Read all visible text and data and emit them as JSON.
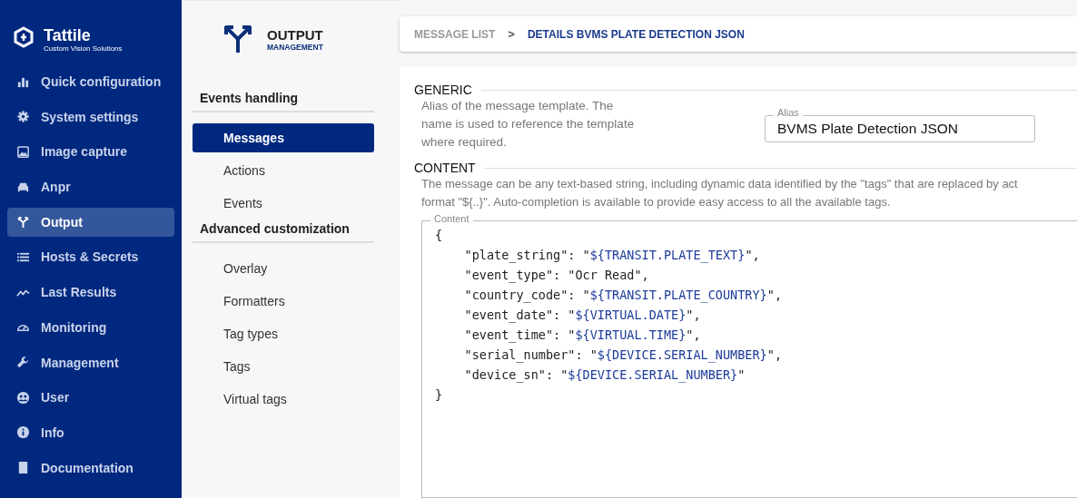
{
  "brand": {
    "name": "Tattile",
    "tagline": "Custom Vision Solutions"
  },
  "nav": [
    {
      "label": "Quick configuration",
      "selected": false
    },
    {
      "label": "System settings",
      "selected": false
    },
    {
      "label": "Image capture",
      "selected": false
    },
    {
      "label": "Anpr",
      "selected": false
    },
    {
      "label": "Output",
      "selected": true
    },
    {
      "label": "Hosts & Secrets",
      "selected": false
    },
    {
      "label": "Last Results",
      "selected": false
    },
    {
      "label": "Monitoring",
      "selected": false
    },
    {
      "label": "Management",
      "selected": false
    },
    {
      "label": "User",
      "selected": false
    },
    {
      "label": "Info",
      "selected": false
    },
    {
      "label": "Documentation",
      "selected": false
    }
  ],
  "section": {
    "title": "OUTPUT",
    "subtitle": "MANAGEMENT"
  },
  "submenu": [
    {
      "heading": "Events handling",
      "items": [
        {
          "label": "Messages",
          "selected": true
        },
        {
          "label": "Actions",
          "selected": false
        },
        {
          "label": "Events",
          "selected": false
        }
      ]
    },
    {
      "heading": "Advanced customization",
      "items": [
        {
          "label": "Overlay",
          "selected": false
        },
        {
          "label": "Formatters",
          "selected": false
        },
        {
          "label": "Tag types",
          "selected": false
        },
        {
          "label": "Tags",
          "selected": false
        },
        {
          "label": "Virtual tags",
          "selected": false
        }
      ]
    }
  ],
  "breadcrumb": {
    "parent": "MESSAGE LIST",
    "separator": ">",
    "current": "DETAILS BVMS PLATE DETECTION JSON"
  },
  "generic": {
    "title": "GENERIC",
    "description": "Alias of the message template. The name is used to reference the template where required.",
    "alias_label": "Alias",
    "alias_value": "BVMS Plate Detection JSON"
  },
  "content": {
    "title": "CONTENT",
    "description": [
      "The message can be any text-based string, including dynamic data identified by the \"tags\" that are replaced by act",
      "format \"${..}\". Auto-completion is available to provide easy access to all the available tags."
    ],
    "editor_label": "Content",
    "lines": [
      [
        {
          "kind": "plain",
          "text": "{"
        }
      ],
      [
        {
          "kind": "plain",
          "text": "    \"plate_string\": \""
        },
        {
          "kind": "tag",
          "text": "${TRANSIT.PLATE_TEXT}"
        },
        {
          "kind": "plain",
          "text": "\","
        }
      ],
      [
        {
          "kind": "plain",
          "text": "    \"event_type\": \"Ocr Read\","
        }
      ],
      [
        {
          "kind": "plain",
          "text": "    \"country_code\": \""
        },
        {
          "kind": "tag",
          "text": "${TRANSIT.PLATE_COUNTRY}"
        },
        {
          "kind": "plain",
          "text": "\","
        }
      ],
      [
        {
          "kind": "plain",
          "text": "    \"event_date\": \""
        },
        {
          "kind": "tag",
          "text": "${VIRTUAL.DATE}"
        },
        {
          "kind": "plain",
          "text": "\","
        }
      ],
      [
        {
          "kind": "plain",
          "text": "    \"event_time\": \""
        },
        {
          "kind": "tag",
          "text": "${VIRTUAL.TIME}"
        },
        {
          "kind": "plain",
          "text": "\","
        }
      ],
      [
        {
          "kind": "plain",
          "text": "    \"serial_number\": \""
        },
        {
          "kind": "tag",
          "text": "${DEVICE.SERIAL_NUMBER}"
        },
        {
          "kind": "plain",
          "text": "\","
        }
      ],
      [
        {
          "kind": "plain",
          "text": "    \"device_sn\": \""
        },
        {
          "kind": "tag",
          "text": "${DEVICE.SERIAL_NUMBER}"
        },
        {
          "kind": "plain",
          "text": "\""
        }
      ],
      [
        {
          "kind": "plain",
          "text": "}"
        }
      ]
    ]
  }
}
